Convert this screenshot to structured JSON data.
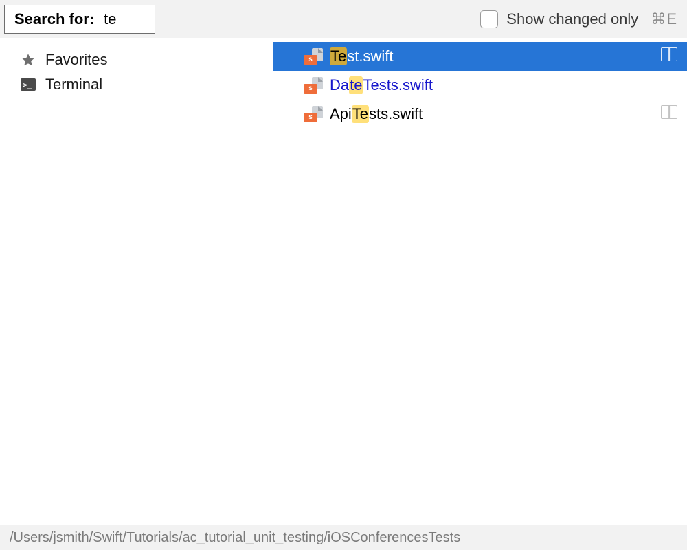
{
  "search": {
    "label": "Search for:",
    "value": "te"
  },
  "toolbar": {
    "show_changed_label": "Show changed only",
    "show_changed_checked": false,
    "shortcut": "⌘E"
  },
  "sidebar": {
    "items": [
      {
        "icon": "star-icon",
        "label": "Favorites"
      },
      {
        "icon": "terminal-icon",
        "label": "Terminal"
      }
    ]
  },
  "results": [
    {
      "pre": "",
      "match": "Te",
      "post": "st.swift",
      "selected": true,
      "link": false,
      "split_icon": true
    },
    {
      "pre": "Da",
      "match": "te",
      "post": "Tests.swift",
      "selected": false,
      "link": true,
      "split_icon": false
    },
    {
      "pre": "Api",
      "match": "Te",
      "post": "sts.swift",
      "selected": false,
      "link": false,
      "split_icon": true
    }
  ],
  "status": {
    "path": "/Users/jsmith/Swift/Tutorials/ac_tutorial_unit_testing/iOSConferencesTests"
  }
}
